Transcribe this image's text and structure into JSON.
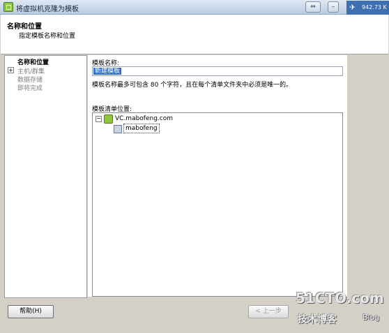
{
  "window": {
    "title": "将虚拟机克隆为模板",
    "tray_text": "942.73 K"
  },
  "header": {
    "title": "名称和位置",
    "subtitle": "指定模板名称和位置"
  },
  "steps": [
    {
      "label": "名称和位置",
      "active": true
    },
    {
      "label": "主机/群集",
      "active": false
    },
    {
      "label": "数据存储",
      "active": false
    },
    {
      "label": "即将完成",
      "active": false
    }
  ],
  "form": {
    "name_label": "模板名称:",
    "name_value": "新建模板",
    "hint": "模板名称最多可包含 80 个字符，且在每个清单文件夹中必须是唯一的。",
    "location_label": "模板清单位置:"
  },
  "tree": {
    "root": "VC.mabofeng.com",
    "child": "mabofeng"
  },
  "buttons": {
    "help": "帮助(H)",
    "back": "< 上一步"
  },
  "watermark": {
    "site": "51CTO.com",
    "tagline": "技术博客",
    "suffix": "Blog"
  }
}
